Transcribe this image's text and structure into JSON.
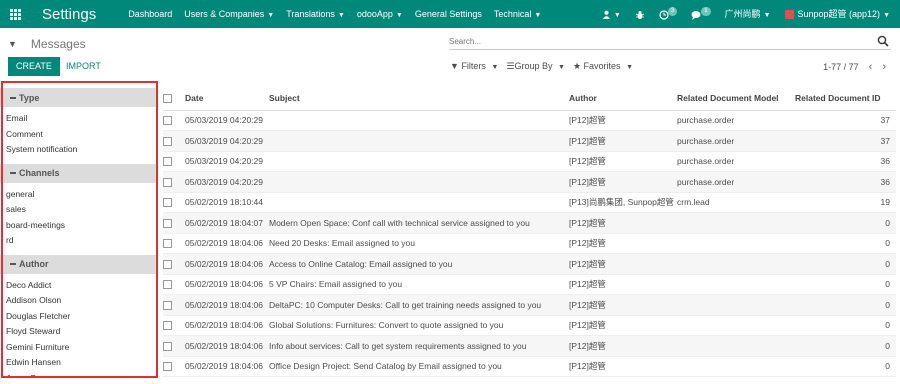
{
  "navbar": {
    "brand": "Settings",
    "menu": [
      {
        "label": "Dashboard",
        "caret": false
      },
      {
        "label": "Users & Companies",
        "caret": true
      },
      {
        "label": "Translations",
        "caret": true
      },
      {
        "label": "odooApp",
        "caret": true
      },
      {
        "label": "General Settings",
        "caret": false
      },
      {
        "label": "Technical",
        "caret": true
      }
    ],
    "activity_count": "3",
    "message_count": "1",
    "company": "广州尚鹏",
    "user": "Sunpop超管 (app12)"
  },
  "control": {
    "breadcrumb": "Messages",
    "search_placeholder": "Search...",
    "create_label": "CREATE",
    "import_label": "IMPORT",
    "filters_label": "Filters",
    "groupby_label": "Group By",
    "favorites_label": "Favorites",
    "pager": "1-77 / 77"
  },
  "sidepanel": {
    "type_title": "Type",
    "type_items": [
      "Email",
      "Comment",
      "System notification"
    ],
    "channels_title": "Channels",
    "channel_items": [
      "general",
      "sales",
      "board-meetings",
      "rd"
    ],
    "author_title": "Author",
    "author_items": [
      "Deco Addict",
      "Addison Olson",
      "Douglas Fletcher",
      "Floyd Steward",
      "Gemini Furniture",
      "Edwin Hansen",
      "Jesse Brown"
    ]
  },
  "table": {
    "columns": [
      "Date",
      "Subject",
      "Author",
      "Related Document Model",
      "Related Document ID"
    ],
    "rows": [
      {
        "date": "05/03/2019 04:20:29",
        "subject": "",
        "author": "[P12]超管",
        "model": "purchase.order",
        "id": "37"
      },
      {
        "date": "05/03/2019 04:20:29",
        "subject": "",
        "author": "[P12]超管",
        "model": "purchase.order",
        "id": "37"
      },
      {
        "date": "05/03/2019 04:20:29",
        "subject": "",
        "author": "[P12]超管",
        "model": "purchase.order",
        "id": "36"
      },
      {
        "date": "05/03/2019 04:20:29",
        "subject": "",
        "author": "[P12]超管",
        "model": "purchase.order",
        "id": "36"
      },
      {
        "date": "05/02/2019 18:10:44",
        "subject": "",
        "author": "[P13]尚鹏集团, Sunpop超管",
        "model": "crm.lead",
        "id": "19"
      },
      {
        "date": "05/02/2019 18:04:07",
        "subject": "Modern Open Space: Conf call with technical service assigned to you",
        "author": "[P12]超管",
        "model": "",
        "id": "0"
      },
      {
        "date": "05/02/2019 18:04:06",
        "subject": "Need 20 Desks: Email assigned to you",
        "author": "[P12]超管",
        "model": "",
        "id": "0"
      },
      {
        "date": "05/02/2019 18:04:06",
        "subject": "Access to Online Catalog: Email assigned to you",
        "author": "[P12]超管",
        "model": "",
        "id": "0"
      },
      {
        "date": "05/02/2019 18:04:06",
        "subject": "5 VP Chairs: Email assigned to you",
        "author": "[P12]超管",
        "model": "",
        "id": "0"
      },
      {
        "date": "05/02/2019 18:04:06",
        "subject": "DeltaPC: 10 Computer Desks: Call to get training needs assigned to you",
        "author": "[P12]超管",
        "model": "",
        "id": "0"
      },
      {
        "date": "05/02/2019 18:04:06",
        "subject": "Global Solutions: Furnitures: Convert to quote assigned to you",
        "author": "[P12]超管",
        "model": "",
        "id": "0"
      },
      {
        "date": "05/02/2019 18:04:06",
        "subject": "Info about services: Call to get system requirements assigned to you",
        "author": "[P12]超管",
        "model": "",
        "id": "0"
      },
      {
        "date": "05/02/2019 18:04:06",
        "subject": "Office Design Project: Send Catalog by Email assigned to you",
        "author": "[P12]超管",
        "model": "",
        "id": "0"
      }
    ]
  },
  "colors": {
    "brand": "#00897b",
    "highlight_frame": "#e03030"
  }
}
